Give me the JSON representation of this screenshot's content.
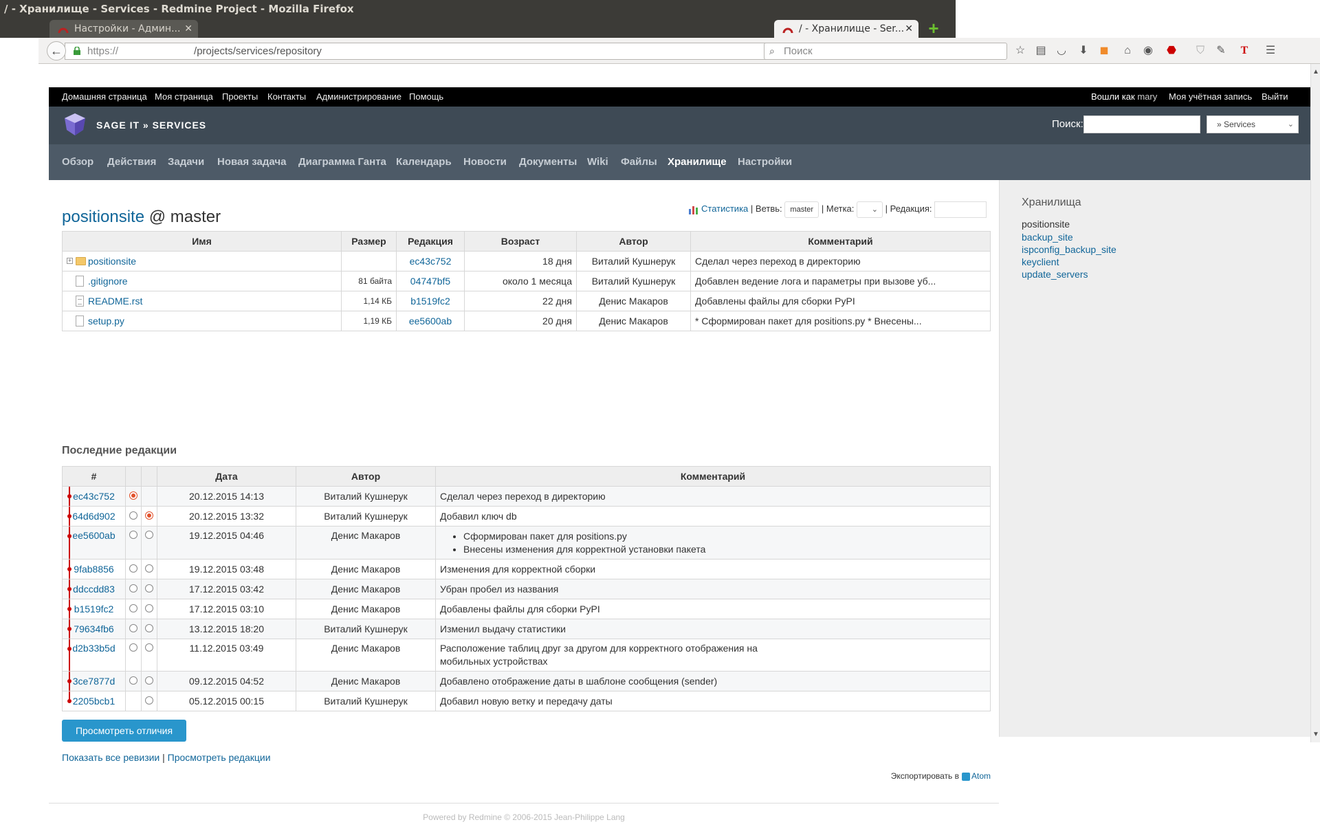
{
  "window": {
    "title": "/ - Хранилище - Services - Redmine Project - Mozilla Firefox"
  },
  "tabs": [
    {
      "label": "Настройки - Админ...",
      "active": false
    },
    {
      "label": "/ - Хранилище - Ser...",
      "active": true
    }
  ],
  "navbar": {
    "url_scheme": "https://",
    "url_path": "/projects/services/repository",
    "search_placeholder": "Поиск"
  },
  "topmenu": {
    "items": [
      "Домашняя страница",
      "Моя страница",
      "Проекты",
      "Контакты",
      "Администрирование",
      "Помощь"
    ],
    "logged_as_label": "Вошли как",
    "logged_as_user": "mary",
    "my_account": "Моя учётная запись",
    "logout": "Выйти"
  },
  "header": {
    "project_title": "SAGE IT » SERVICES",
    "search_label": "Поиск:",
    "project_jump": "» Services"
  },
  "mainmenu": {
    "items": [
      "Обзор",
      "Действия",
      "Задачи",
      "Новая задача",
      "Диаграмма Ганта",
      "Календарь",
      "Новости",
      "Документы",
      "Wiki",
      "Файлы",
      "Хранилище",
      "Настройки"
    ],
    "selected": "Хранилище"
  },
  "repository": {
    "name": "positionsite",
    "at": "@ master",
    "stats_label": "Статистика",
    "branch_label": "| Ветвь:",
    "branch_value": "master",
    "tag_label": "| Метка:",
    "revision_label": "| Редакция:"
  },
  "entries": {
    "headers": [
      "Имя",
      "Размер",
      "Редакция",
      "Возраст",
      "Автор",
      "Комментарий"
    ],
    "rows": [
      {
        "name": "positionsite",
        "type": "dir",
        "size": "",
        "rev": "ec43c752",
        "age": "18 дня",
        "author": "Виталий Кушнерук",
        "comment": "Сделал через переход в директорию"
      },
      {
        "name": ".gitignore",
        "type": "file",
        "size": "81 байта",
        "rev": "04747bf5",
        "age": "около 1 месяца",
        "author": "Виталий Кушнерук",
        "comment": "Добавлен ведение лога и параметры при вызове уб..."
      },
      {
        "name": "README.rst",
        "type": "text",
        "size": "1,14 КБ",
        "rev": "b1519fc2",
        "age": "22 дня",
        "author": "Денис Макаров",
        "comment": "Добавлены файлы для сборки PyPI"
      },
      {
        "name": "setup.py",
        "type": "file",
        "size": "1,19 КБ",
        "rev": "ee5600ab",
        "age": "20 дня",
        "author": "Денис Макаров",
        "comment": "* Сформирован пакет для positions.py * Внесены..."
      }
    ]
  },
  "changesets": {
    "title": "Последние редакции",
    "headers": [
      "#",
      "Дата",
      "Автор",
      "Комментарий"
    ],
    "rows": [
      {
        "rev": "ec43c752",
        "date": "20.12.2015 14:13",
        "author": "Виталий Кушнерук",
        "comment": "Сделал через переход в директорию"
      },
      {
        "rev": "64d6d902",
        "date": "20.12.2015 13:32",
        "author": "Виталий Кушнерук",
        "comment": "Добавил ключ db"
      },
      {
        "rev": "ee5600ab",
        "date": "19.12.2015 04:46",
        "author": "Денис Макаров",
        "comment_items": [
          "Сформирован пакет для positions.py",
          "Внесены изменения для корректной установки пакета"
        ]
      },
      {
        "rev": "9fab8856",
        "date": "19.12.2015 03:48",
        "author": "Денис Макаров",
        "comment": "Изменения для корректной сборки"
      },
      {
        "rev": "ddccdd83",
        "date": "17.12.2015 03:42",
        "author": "Денис Макаров",
        "comment": "Убран пробел из названия"
      },
      {
        "rev": "b1519fc2",
        "date": "17.12.2015 03:10",
        "author": "Денис Макаров",
        "comment": "Добавлены файлы для сборки PyPI"
      },
      {
        "rev": "79634fb6",
        "date": "13.12.2015 18:20",
        "author": "Виталий Кушнерук",
        "comment": "Изменил выдачу статистики"
      },
      {
        "rev": "d2b33b5d",
        "date": "11.12.2015 03:49",
        "author": "Денис Макаров",
        "comment_lines": [
          "Расположение таблиц друг за другом для корректного отображения на",
          "мобильных устройствах"
        ]
      },
      {
        "rev": "3ce7877d",
        "date": "09.12.2015 04:52",
        "author": "Денис Макаров",
        "comment": "Добавлено отображение даты в шаблоне сообщения (sender)"
      },
      {
        "rev": "2205bcb1",
        "date": "05.12.2015 00:15",
        "author": "Виталий Кушнерук",
        "comment": "Добавил новую ветку и передачу даты"
      }
    ]
  },
  "actions": {
    "diff_button": "Просмотреть отличия",
    "show_all": "Показать все ревизии",
    "separator": "|",
    "view_revisions": "Просмотреть редакции",
    "export_label": "Экспортировать в",
    "atom": "Atom"
  },
  "sidebar": {
    "title": "Хранилища",
    "repos": [
      "positionsite",
      "backup_site",
      "ispconfig_backup_site",
      "keyclient",
      "update_servers"
    ],
    "current": "positionsite"
  },
  "footer": {
    "text": "Powered by Redmine © 2006-2015 Jean-Philippe Lang"
  },
  "colors": {
    "header_bg": "#3e4a55",
    "menu_bg": "#4d5a67",
    "link": "#169",
    "button": "#2996cc",
    "graph": "#cc0000"
  }
}
